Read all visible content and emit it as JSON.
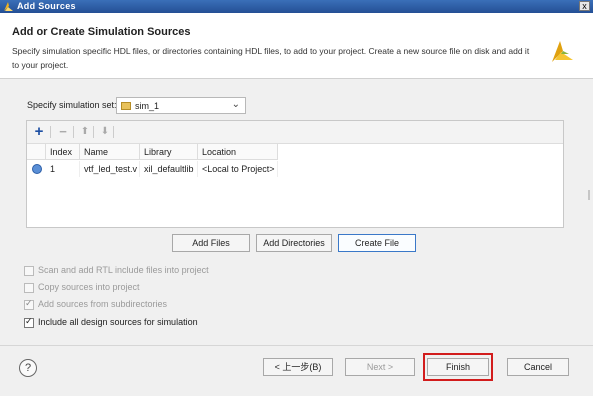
{
  "window": {
    "title": "Add Sources",
    "close_label": "x"
  },
  "header": {
    "title": "Add or Create Simulation Sources",
    "description": "Specify simulation specific HDL files, or directories containing HDL files, to add to your project. Create a new source file on disk and add it to your project."
  },
  "simset": {
    "label": "Specify simulation set:",
    "value": "sim_1"
  },
  "table": {
    "columns": [
      "Index",
      "Name",
      "Library",
      "Location"
    ],
    "rows": [
      {
        "index": "1",
        "name": "vtf_led_test.v",
        "library": "xil_defaultlib",
        "location": "<Local to Project>"
      }
    ]
  },
  "actions": {
    "add_files": "Add Files",
    "add_directories": "Add Directories",
    "create_file": "Create File"
  },
  "options": [
    {
      "label": "Scan and add RTL include files into project",
      "checked": false,
      "enabled": false
    },
    {
      "label": "Copy sources into project",
      "checked": false,
      "enabled": false
    },
    {
      "label": "Add sources from subdirectories",
      "checked": true,
      "enabled": false
    },
    {
      "label": "Include all design sources for simulation",
      "checked": true,
      "enabled": true
    }
  ],
  "footer": {
    "help": "?",
    "back": "< 上一步(B)",
    "next": "Next >",
    "finish": "Finish",
    "cancel": "Cancel"
  },
  "colors": {
    "highlight_border": "#d21c1c",
    "titlebar": "#2f5fa8",
    "accent": "#3a78c8"
  }
}
